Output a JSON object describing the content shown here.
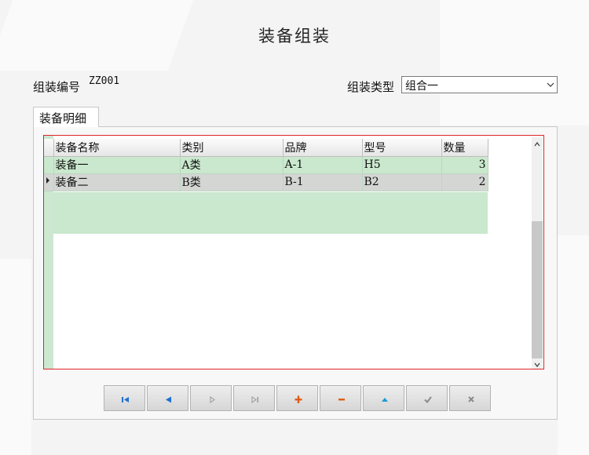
{
  "title": "装备组装",
  "assembly": {
    "code_label": "组装编号",
    "code_value": "ZZ001",
    "type_label": "组装类型",
    "type_value": "组合一"
  },
  "tab": {
    "label": "装备明细"
  },
  "grid": {
    "columns": [
      "装备名称",
      "类别",
      "品牌",
      "型号",
      "数量"
    ],
    "rows": [
      [
        "装备一",
        "A类",
        "A-1",
        "H5",
        "3"
      ],
      [
        "装备二",
        "B类",
        "B-1",
        "B2",
        "2"
      ]
    ]
  },
  "navigator": {
    "buttons": [
      "first-icon",
      "prior-icon",
      "next-icon",
      "last-icon",
      "insert-icon",
      "delete-icon",
      "edit-icon",
      "post-icon",
      "cancel-icon"
    ]
  },
  "colors": {
    "grid_row": "#c9e8cd",
    "selected_row": "#d4d6d4",
    "grid_border": "#e0242a",
    "nav_blue": "#1f6fd6",
    "nav_orange": "#e05a14"
  }
}
